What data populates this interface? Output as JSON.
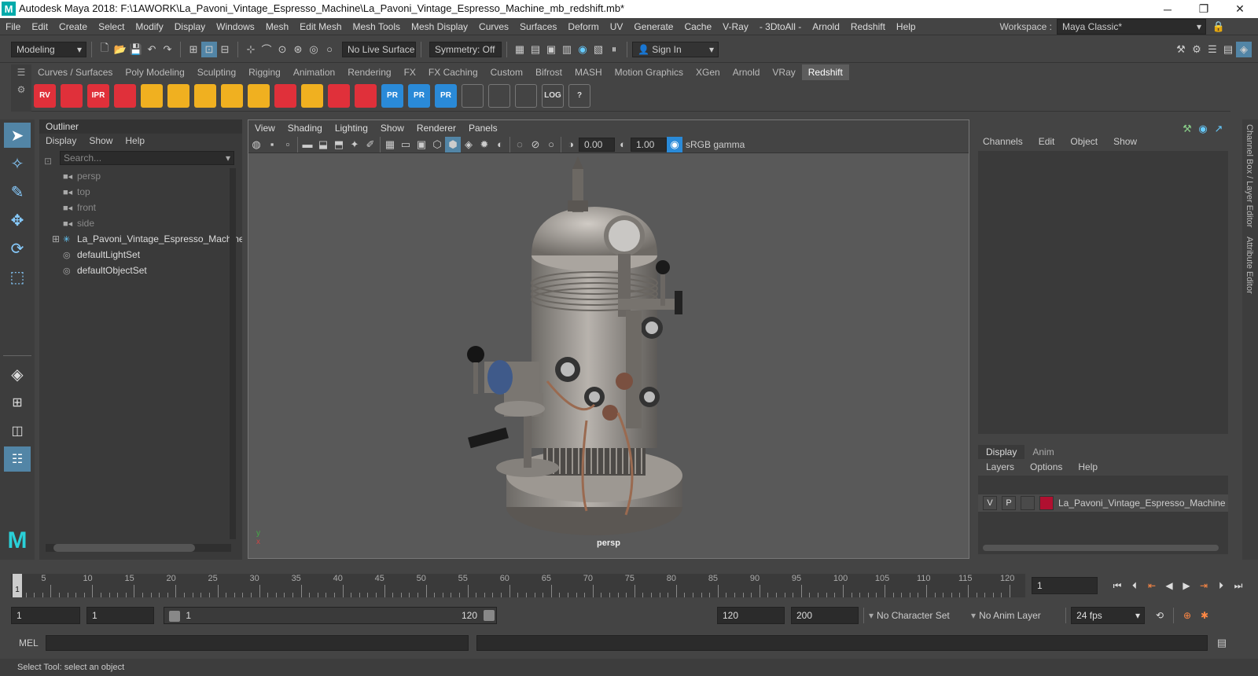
{
  "titlebar": {
    "title": "Autodesk Maya 2018: F:\\1AWORK\\La_Pavoni_Vintage_Espresso_Machine\\La_Pavoni_Vintage_Espresso_Machine_mb_redshift.mb*",
    "logo": "M"
  },
  "menubar": [
    "File",
    "Edit",
    "Create",
    "Select",
    "Modify",
    "Display",
    "Windows",
    "Mesh",
    "Edit Mesh",
    "Mesh Tools",
    "Mesh Display",
    "Curves",
    "Surfaces",
    "Deform",
    "UV",
    "Generate",
    "Cache",
    "V-Ray",
    "- 3DtoAll -",
    "Arnold",
    "Redshift",
    "Help"
  ],
  "workspace": {
    "label": "Workspace :",
    "value": "Maya Classic*"
  },
  "statusline": {
    "mode": "Modeling",
    "live_surface": "No Live Surface",
    "symmetry": "Symmetry: Off",
    "sign_in": "Sign In"
  },
  "shelf_tabs": [
    "Curves / Surfaces",
    "Poly Modeling",
    "Sculpting",
    "Rigging",
    "Animation",
    "Rendering",
    "FX",
    "FX Caching",
    "Custom",
    "Bifrost",
    "MASH",
    "Motion Graphics",
    "XGen",
    "Arnold",
    "VRay",
    "Redshift"
  ],
  "shelf_active_tab": "Redshift",
  "shelf_icons": [
    {
      "label": "RV",
      "color": "#e0303a"
    },
    {
      "label": "",
      "color": "#e0303a"
    },
    {
      "label": "IPR",
      "color": "#e0303a"
    },
    {
      "label": "",
      "color": "#e0303a"
    },
    {
      "label": "",
      "color": "#f0b020"
    },
    {
      "label": "",
      "color": "#f0b020"
    },
    {
      "label": "",
      "color": "#f0b020"
    },
    {
      "label": "",
      "color": "#f0b020"
    },
    {
      "label": "",
      "color": "#f0b020"
    },
    {
      "label": "",
      "color": "#e0303a"
    },
    {
      "label": "",
      "color": "#f0b020"
    },
    {
      "label": "",
      "color": "#e0303a"
    },
    {
      "label": "",
      "color": "#e0303a"
    },
    {
      "label": "PR",
      "color": "#2a8ad8"
    },
    {
      "label": "PR",
      "color": "#2a8ad8"
    },
    {
      "label": "PR",
      "color": "#2a8ad8"
    },
    {
      "label": "",
      "color": "#cccccc"
    },
    {
      "label": "",
      "color": "#cccccc"
    },
    {
      "label": "",
      "color": "#cccccc"
    },
    {
      "label": "LOG",
      "color": "#cccccc"
    },
    {
      "label": "?",
      "color": "#cccccc"
    }
  ],
  "outliner": {
    "title": "Outliner",
    "menu": [
      "Display",
      "Show",
      "Help"
    ],
    "search_placeholder": "Search...",
    "items": [
      {
        "label": "persp",
        "dim": true,
        "icon": "camera-icon"
      },
      {
        "label": "top",
        "dim": true,
        "icon": "camera-icon"
      },
      {
        "label": "front",
        "dim": true,
        "icon": "camera-icon"
      },
      {
        "label": "side",
        "dim": true,
        "icon": "camera-icon"
      },
      {
        "label": "La_Pavoni_Vintage_Espresso_Machine",
        "dim": false,
        "icon": "group-icon"
      },
      {
        "label": "defaultLightSet",
        "dim": false,
        "icon": "set-icon"
      },
      {
        "label": "defaultObjectSet",
        "dim": false,
        "icon": "set-icon"
      }
    ]
  },
  "viewport": {
    "menu": [
      "View",
      "Shading",
      "Lighting",
      "Show",
      "Renderer",
      "Panels"
    ],
    "exposure": "0.00",
    "gamma": "1.00",
    "colorspace": "sRGB gamma",
    "camera_label": "persp"
  },
  "channelbox": {
    "menu": [
      "Channels",
      "Edit",
      "Object",
      "Show"
    ],
    "vertical_tabs": [
      "Channel Box / Layer Editor",
      "Attribute Editor"
    ]
  },
  "layers": {
    "tabs": [
      "Display",
      "Anim"
    ],
    "active_tab": "Display",
    "menu": [
      "Layers",
      "Options",
      "Help"
    ],
    "rows": [
      {
        "v": "V",
        "p": "P",
        "name": "La_Pavoni_Vintage_Espresso_Machine",
        "color": "#b01030"
      }
    ]
  },
  "timeline": {
    "ticks": [
      5,
      10,
      15,
      20,
      25,
      30,
      35,
      40,
      45,
      50,
      55,
      60,
      65,
      70,
      75,
      80,
      85,
      90,
      95,
      100,
      105,
      110,
      115,
      120
    ],
    "max": 120,
    "current_frame_marker": "1",
    "current_frame": "1"
  },
  "range": {
    "start": "1",
    "playback_start": "1",
    "slider_start": "1",
    "slider_end": "120",
    "playback_end": "120",
    "end": "200",
    "character_set": "No Character Set",
    "anim_layer": "No Anim Layer",
    "fps": "24 fps"
  },
  "cmdline": {
    "label": "MEL"
  },
  "helpline": "Select Tool: select an object"
}
